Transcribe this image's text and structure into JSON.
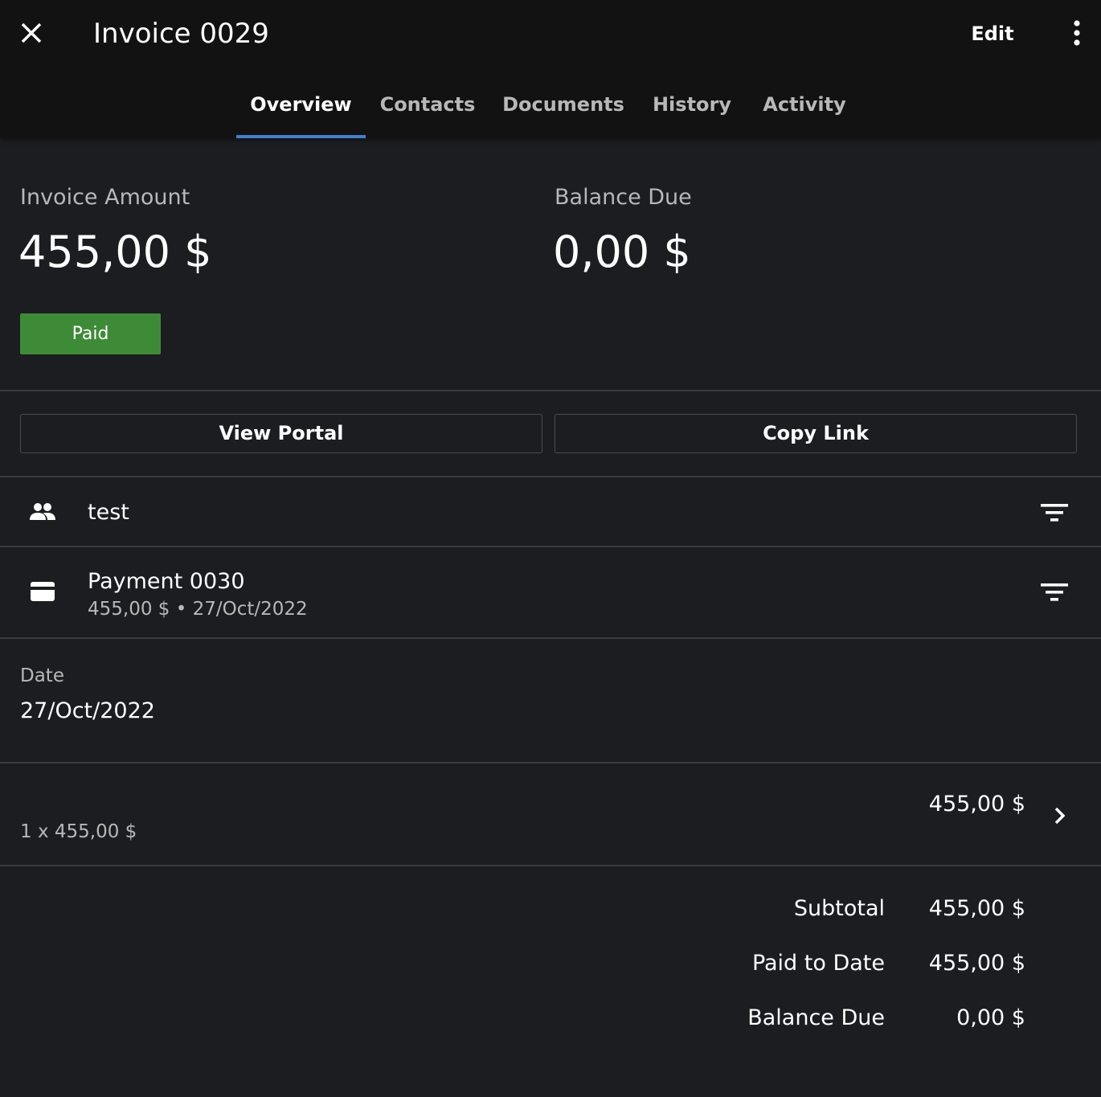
{
  "header": {
    "title": "Invoice 0029",
    "edit_label": "Edit",
    "close_icon": "close-icon",
    "more_icon": "more-vertical-icon"
  },
  "tabs": [
    {
      "label": "Overview",
      "active": true
    },
    {
      "label": "Contacts",
      "active": false
    },
    {
      "label": "Documents",
      "active": false
    },
    {
      "label": "History",
      "active": false
    },
    {
      "label": "Activity",
      "active": false
    }
  ],
  "summary": {
    "invoice_amount_label": "Invoice Amount",
    "invoice_amount": "455,00 $",
    "balance_due_label": "Balance Due",
    "balance_due": "0,00 $",
    "status": "Paid",
    "status_color": "#3d8b37"
  },
  "actions": {
    "view_portal": "View Portal",
    "copy_link": "Copy Link"
  },
  "client": {
    "name": "test",
    "icon": "people-icon"
  },
  "payment": {
    "title": "Payment 0030",
    "subtitle": "455,00 $ • 27/Oct/2022",
    "icon": "credit-card-icon"
  },
  "date": {
    "label": "Date",
    "value": "27/Oct/2022"
  },
  "line_item": {
    "amount": "455,00 $",
    "detail": "1 x 455,00 $"
  },
  "totals": [
    {
      "label": "Subtotal",
      "value": "455,00 $"
    },
    {
      "label": "Paid to Date",
      "value": "455,00 $"
    },
    {
      "label": "Balance Due",
      "value": "0,00 $"
    }
  ],
  "colors": {
    "accent": "#3f7fcf",
    "background": "#1c1d20",
    "topbar": "#121212"
  }
}
